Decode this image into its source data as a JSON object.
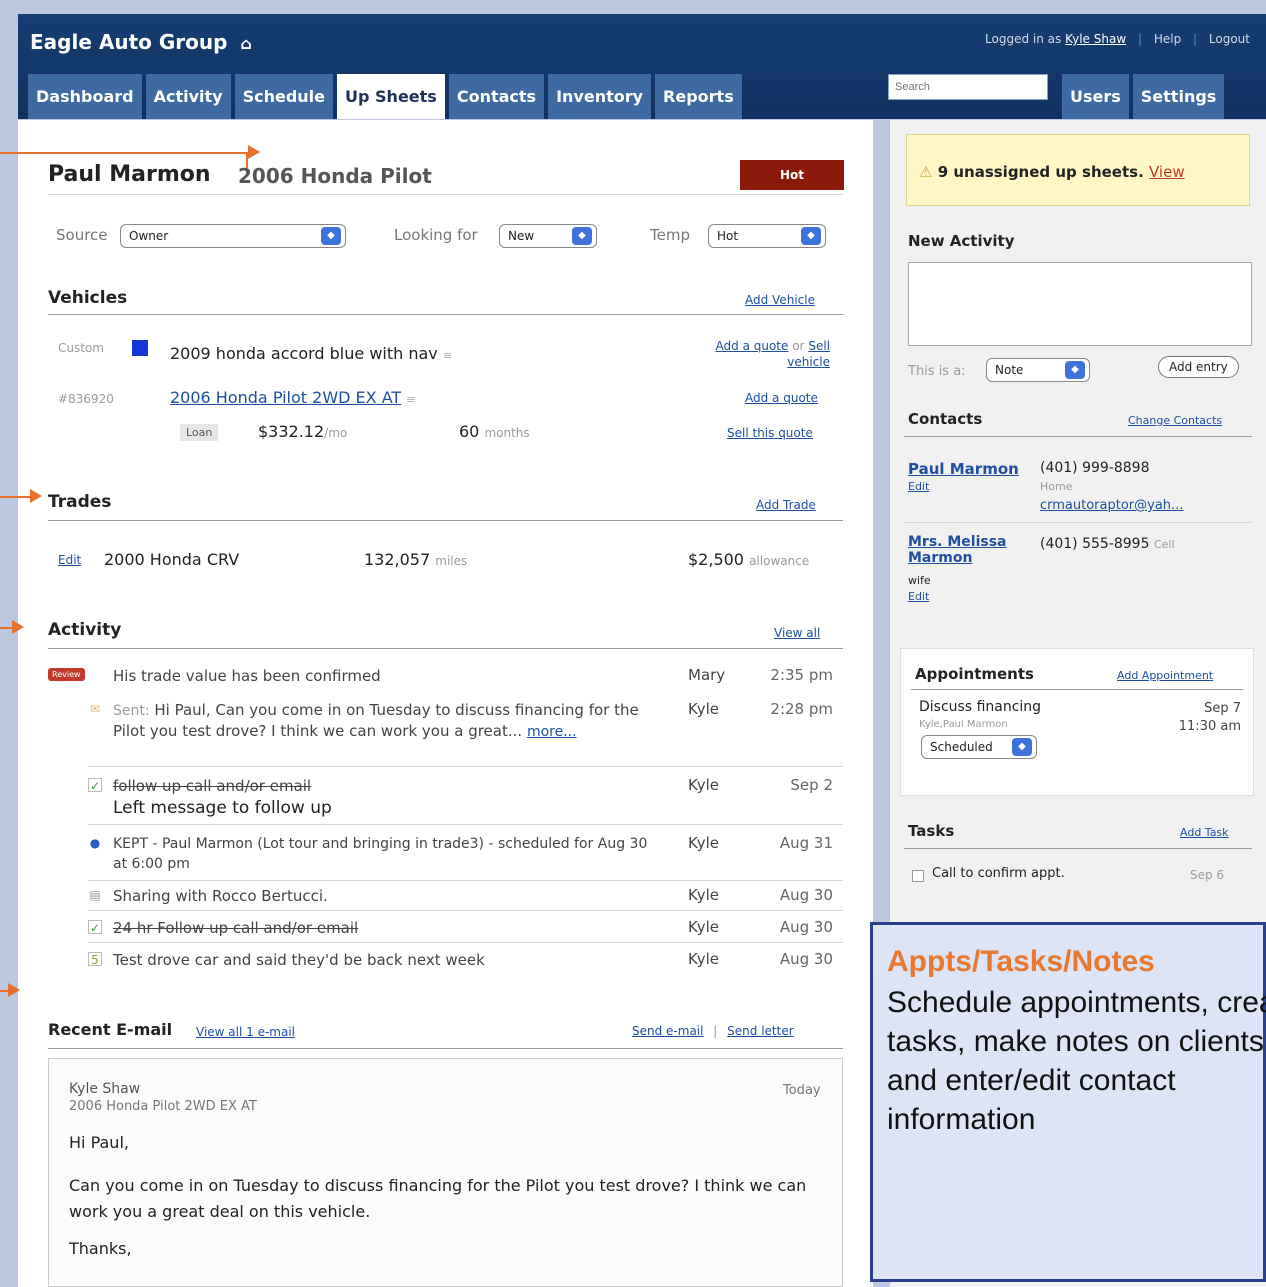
{
  "header": {
    "brand": "Eagle Auto Group",
    "logged_in_prefix": "Logged in as",
    "user": "Kyle Shaw",
    "help": "Help",
    "logout": "Logout",
    "search_placeholder": "Search"
  },
  "nav": {
    "tabs": [
      "Dashboard",
      "Activity",
      "Schedule",
      "Up Sheets",
      "Contacts",
      "Inventory",
      "Reports"
    ],
    "active": "Up Sheets",
    "right_tabs": [
      "Users",
      "Settings"
    ]
  },
  "upsheet": {
    "name": "Paul Marmon",
    "vehicle": "2006 Honda Pilot",
    "hot_label": "Hot",
    "source_label": "Source",
    "source_value": "Owner",
    "looking_label": "Looking for",
    "looking_value": "New",
    "temp_label": "Temp",
    "temp_value": "Hot"
  },
  "vehicles": {
    "heading": "Vehicles",
    "add": "Add Vehicle",
    "custom_label": "Custom",
    "custom_desc": "2009 honda accord blue with nav",
    "add_quote_or_sell_1": "Add a quote",
    "or": "or",
    "sell": "Sell vehicle",
    "stock": "#836920",
    "stock_vehicle": "2006 Honda Pilot 2WD EX AT",
    "add_quote_2": "Add a quote",
    "loan_badge": "Loan",
    "payment": "$332.12",
    "per": "/mo",
    "months": "60",
    "months_label": "months",
    "sell_quote": "Sell this quote"
  },
  "trades": {
    "heading": "Trades",
    "add": "Add Trade",
    "edit": "Edit",
    "vehicle": "2000 Honda CRV",
    "miles": "132,057",
    "miles_label": "miles",
    "allowance": "$2,500",
    "allowance_label": "allowance"
  },
  "activity": {
    "heading": "Activity",
    "view_all": "View all",
    "review_badge": "Review",
    "rows": [
      {
        "text": "His trade value has been confirmed",
        "who": "Mary",
        "when": "2:35 pm"
      },
      {
        "text_prefix": "Sent:",
        "text": "Hi Paul, Can you come in on Tuesday to discuss financing for the Pilot you test drove? I think we can work you a great...",
        "more": "more...",
        "who": "Kyle",
        "when": "2:28 pm"
      },
      {
        "text": "follow up call and/or email",
        "sub": "Left message to follow up",
        "who": "Kyle",
        "when": "Sep 2"
      },
      {
        "text": "KEPT - Paul Marmon (Lot tour and bringing in trade3) - scheduled for Aug 30 at 6:00 pm",
        "who": "Kyle",
        "when": "Aug 31"
      },
      {
        "text": "Sharing with Rocco Bertucci.",
        "who": "Kyle",
        "when": "Aug 30"
      },
      {
        "text": "24 hr Follow up call and/or email",
        "who": "Kyle",
        "when": "Aug 30"
      },
      {
        "text": "Test drove car and said they'd be back next week",
        "who": "Kyle",
        "when": "Aug 30"
      }
    ]
  },
  "email": {
    "heading": "Recent E-mail",
    "view_all": "View all 1 e-mail",
    "send_email": "Send e-mail",
    "send_letter": "Send letter",
    "from": "Kyle Shaw",
    "vehicle": "2006 Honda Pilot 2WD EX AT",
    "date": "Today",
    "greeting": "Hi Paul,",
    "body": "Can you come in on Tuesday to discuss financing for the Pilot you test drove? I think we can work you a great deal on this vehicle.",
    "closing": "Thanks,"
  },
  "sidebar": {
    "notice_text": "9 unassigned up sheets.",
    "notice_link": "View",
    "new_activity": "New Activity",
    "this_is_a": "This is a:",
    "type_value": "Note",
    "add_entry": "Add entry",
    "contacts_heading": "Contacts",
    "change_contacts": "Change Contacts",
    "contacts": [
      {
        "name": "Paul Marmon",
        "edit": "Edit",
        "phone": "(401) 999-8898",
        "phone_type": "Home",
        "email": "crmautoraptor@yah..."
      },
      {
        "name": "Mrs. Melissa Marmon",
        "relation": "wife",
        "edit": "Edit",
        "phone": "(401) 555-8995",
        "phone_type": "Cell"
      }
    ],
    "appointments_heading": "Appointments",
    "add_appointment": "Add Appointment",
    "appt_title": "Discuss financing",
    "appt_people": "Kyle,Paul Marmon",
    "appt_status": "Scheduled",
    "appt_date": "Sep 7",
    "appt_time": "11:30 am",
    "tasks_heading": "Tasks",
    "add_task": "Add Task",
    "task_text": "Call to confirm appt.",
    "task_date": "Sep 6"
  },
  "callout": {
    "title": "Appts/Tasks/Notes",
    "body": "Schedule appointments, create tasks, make notes on clients, and enter/edit contact information"
  },
  "colors": {
    "header_bg": "#163e72",
    "tab_bg": "#3e6aa2",
    "hot": "#8b1a0a",
    "accent_arrow": "#e8702a",
    "callout_title": "#e8782f"
  }
}
